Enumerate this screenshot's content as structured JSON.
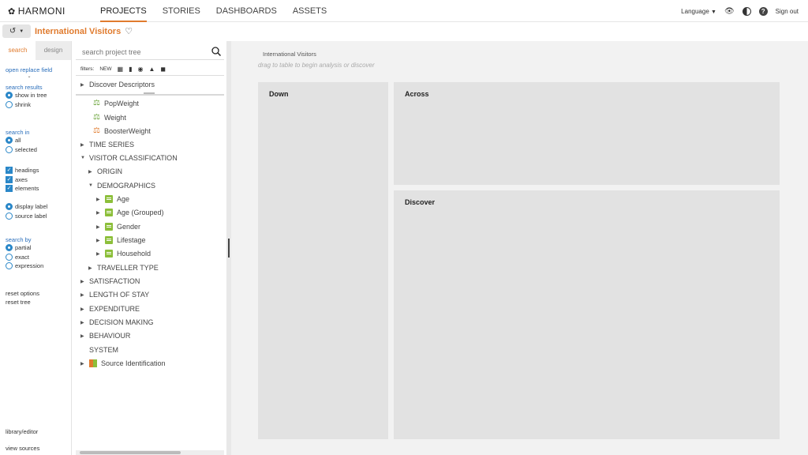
{
  "app": {
    "logo": "HARMONI"
  },
  "nav": {
    "items": [
      "PROJECTS",
      "STORIES",
      "DASHBOARDS",
      "ASSETS"
    ]
  },
  "top_right": {
    "language": "Language",
    "sign_out": "Sign out"
  },
  "project": {
    "title": "International Visitors"
  },
  "left_panel": {
    "tabs": [
      "search",
      "design"
    ],
    "open_replace": "open replace field",
    "search_results": {
      "heading": "search results",
      "options": [
        "show in tree",
        "shrink"
      ]
    },
    "search_in": {
      "heading": "search in",
      "options": [
        "all",
        "selected"
      ]
    },
    "checks": [
      "headings",
      "axes",
      "elements"
    ],
    "label_opts": [
      "display label",
      "source label"
    ],
    "search_by": {
      "heading": "search by",
      "options": [
        "partial",
        "exact",
        "expression"
      ]
    },
    "reset_options": "reset options",
    "reset_tree": "reset tree",
    "library_editor": "library/editor",
    "view_sources": "view sources"
  },
  "tree_panel": {
    "search_placeholder": "search project tree",
    "filters_label": "filters:",
    "filter_new": "NEW",
    "nodes": {
      "discover_descriptors": "Discover Descriptors",
      "popweight": "PopWeight",
      "weight": "Weight",
      "boosterweight": "BoosterWeight",
      "time_series": "TIME SERIES",
      "visitor_classification": "VISITOR CLASSIFICATION",
      "origin": "ORIGIN",
      "demographics": "DEMOGRAPHICS",
      "age": "Age",
      "age_grouped": "Age (Grouped)",
      "gender": "Gender",
      "lifestage": "Lifestage",
      "household": "Household",
      "traveller_type": "TRAVELLER TYPE",
      "satisfaction": "SATISFACTION",
      "length_of_stay": "LENGTH OF STAY",
      "expenditure": "EXPENDITURE",
      "decision_making": "DECISION MAKING",
      "behaviour": "BEHAVIOUR",
      "system": "SYSTEM",
      "source_identification": "Source Identification"
    }
  },
  "main": {
    "title": "International Visitors",
    "hint": "drag to table to begin analysis or discover",
    "zones": {
      "down": "Down",
      "across": "Across",
      "discover": "Discover"
    }
  },
  "colors": {
    "accent": "#e07b2e",
    "link": "#2a6ebb",
    "control": "#2a87c8",
    "variable_icon": "#8cbf3a"
  }
}
